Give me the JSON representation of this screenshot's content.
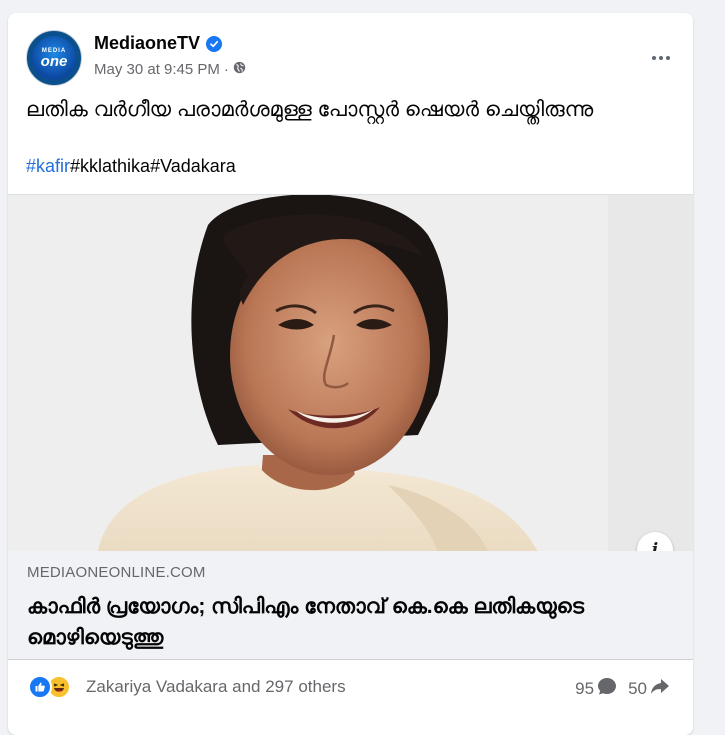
{
  "post": {
    "page_name": "MediaoneTV",
    "avatar_text_top": "MEDIA",
    "avatar_text_bottom": "one",
    "timestamp": "May 30 at 9:45 PM",
    "separator": "·",
    "audience_icon": "globe-icon",
    "more_icon": "more-options-icon",
    "text": "ലതിക വർഗീയ പരാമർശമുള്ള പോസ്റ്റർ ഷെയർ ചെയ്തിരുന്നു",
    "hashtags": [
      "#kafir",
      "#kklathika",
      "#Vadakara"
    ]
  },
  "link_preview": {
    "domain": "MEDIAONEONLINE.COM",
    "title": "കാഫിർ പ്രയോഗം; സിപിഎം നേതാവ് കെ.കെ ലതികയുടെ മൊഴിയെടുത്തു",
    "info_icon_label": "i"
  },
  "engagement": {
    "reaction_icons": [
      "like-icon",
      "haha-icon"
    ],
    "reactions_text": "Zakariya Vadakara and 297 others",
    "comments_count": "95",
    "shares_count": "50"
  },
  "colors": {
    "accent": "#1877f2",
    "hashtag_link": "#216fdb",
    "secondary_text": "#65676b",
    "page_background": "#f0f2f5"
  }
}
